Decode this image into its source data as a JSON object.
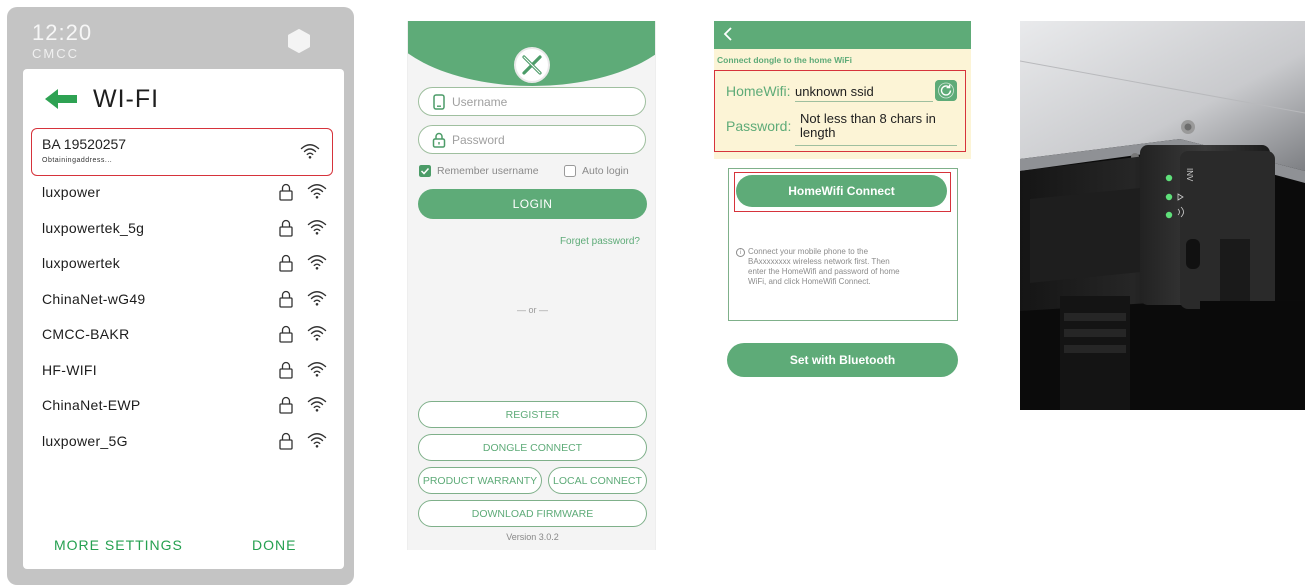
{
  "wifi_panel": {
    "status_time": "12:20",
    "status_carrier": "CMCC",
    "title": "WI-FI",
    "selected": {
      "ssid": "BA 19520257",
      "status": "Obtainingaddress..."
    },
    "networks": [
      {
        "ssid": "luxpower"
      },
      {
        "ssid": "luxpowertek_5g"
      },
      {
        "ssid": "luxpowertek"
      },
      {
        "ssid": "ChinaNet-wG49"
      },
      {
        "ssid": "CMCC-BAKR"
      },
      {
        "ssid": "HF-WIFI"
      },
      {
        "ssid": "ChinaNet-EWP"
      },
      {
        "ssid": "luxpower_5G"
      }
    ],
    "more_settings": "MORE SETTINGS",
    "done": "DONE"
  },
  "login_panel": {
    "logo_letter": "X",
    "username_placeholder": "Username",
    "password_placeholder": "Password",
    "remember_username": "Remember username",
    "auto_login": "Auto login",
    "login": "LOGIN",
    "forget_password": "Forget password?",
    "or_divider": "— or —",
    "register": "REGISTER",
    "dongle_connect": "DONGLE CONNECT",
    "product_warranty": "PRODUCT WARRANTY",
    "local_connect": "LOCAL CONNECT",
    "download_firmware": "DOWNLOAD FIRMWARE",
    "version": "Version 3.0.2"
  },
  "homewifi_panel": {
    "hint": "Connect dongle to the home WiFi",
    "homewifi_label": "HomeWifi:",
    "homewifi_value": "unknown ssid",
    "password_label": "Password:",
    "password_value_line1": "Not less than 8 chars in",
    "password_value_line2": "length",
    "connect_button": "HomeWifi Connect",
    "info_line1": "Connect your mobile phone to the",
    "info_line2": "BAxxxxxxxx wireless network first. Then",
    "info_line3": "enter the HomeWifi and password of home",
    "info_line4": "WiFi, and click HomeWifi Connect.",
    "bluetooth_button": "Set with Bluetooth"
  },
  "device_photo": {
    "indicator_label": "INV",
    "led_color": "#5fe07a"
  },
  "colors": {
    "accent_green": "#5eab78",
    "highlight_red": "#d6333b",
    "banner_yellow": "#fcf4d6",
    "wifi_done_green": "#25a050"
  },
  "icons": [
    "hexagon-icon",
    "back-arrow-icon",
    "wifi-icon",
    "lock-icon",
    "user-icon",
    "password-lock-icon",
    "checkbox-checked-icon",
    "checkbox-icon",
    "back-chevron-icon",
    "refresh-icon",
    "info-icon"
  ]
}
